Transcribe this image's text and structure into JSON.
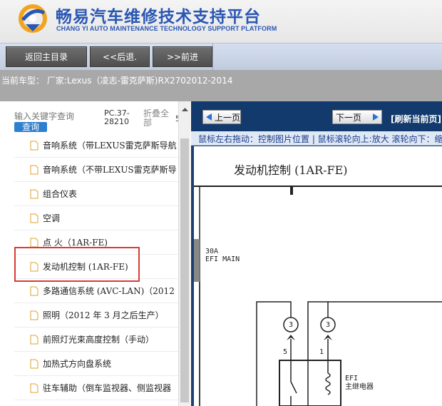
{
  "brand": {
    "title": "畅易汽车维修技术支持平台",
    "subtitle": "CHANG YI AUTO MAINTENANCE TECHNOLOGY SUPPORT PLATFORM",
    "logo_icon": "cy-logo-icon"
  },
  "nav": {
    "home_label": "返回主目录",
    "back_label": "<<后退.",
    "forward_label": ">>前进"
  },
  "model": {
    "text": "当前车型： 厂家:Lexus（凌志-雷克萨斯)RX2702012-2014"
  },
  "search": {
    "placeholder": "输入关键字查询",
    "button_label": "查询",
    "pc_code": "PC.37-28210",
    "collapse_label": "折叠全部",
    "cut_digit": "5"
  },
  "tree": {
    "items": [
      {
        "label": "音响系统（带LEXUS雷克萨斯导航"
      },
      {
        "label": "音响系统（不带LEXUS雷克萨斯导"
      },
      {
        "label": "组合仪表"
      },
      {
        "label": "空调"
      },
      {
        "label": "点 火（1AR-FE)"
      },
      {
        "label": "发动机控制 (1AR-FE)"
      },
      {
        "label": "多路通信系统 (AVC-LAN)（2012"
      },
      {
        "label": "照明（2012 年 3 月之后生产）"
      },
      {
        "label": "前照灯光束高度控制（手动）"
      },
      {
        "label": "加热式方向盘系统"
      },
      {
        "label": "驻车辅助（倒车监视器、侧监视器"
      }
    ],
    "selected_index": 5
  },
  "viewer": {
    "prev_label": "上一页",
    "next_label": "下一页",
    "refresh_label": "[刷新当前页]",
    "hint": "鼠标左右拖动：控制图片位置 | 鼠标滚轮向上:放大  滚轮向下：缩小",
    "diagram": {
      "title": "发动机控制 (1AR-FE)",
      "fuse_amp": "30A",
      "fuse_name": "EFI MAIN",
      "connector_a": "3",
      "connector_b": "3",
      "pin_left": "5",
      "pin_right": "1",
      "relay_label_1": "EFI",
      "relay_label_2": "主继电器"
    }
  },
  "colors": {
    "brand_blue": "#2a56b4",
    "nav_button": "#5a5a5a",
    "model_bar": "#a8a8a8",
    "viewer_bg": "#1e3f72",
    "highlight": "#d93a36",
    "search_button": "#2f7fcf"
  }
}
